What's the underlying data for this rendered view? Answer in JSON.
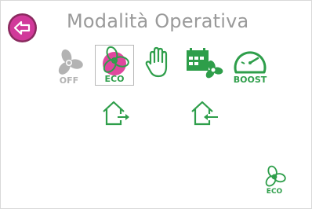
{
  "header": {
    "title": "Modalità Operativa",
    "back_icon": "back-arrow-icon"
  },
  "modes": [
    {
      "id": "off",
      "label": "OFF",
      "icon": "fan-icon",
      "color": "#b3b3b3",
      "selected": false
    },
    {
      "id": "eco",
      "label": "ECO",
      "icon": "fan-icon",
      "color": "#2e9e4a",
      "selected": true
    },
    {
      "id": "manual",
      "label": "",
      "icon": "hand-icon",
      "color": "#2e9e4a",
      "selected": false
    },
    {
      "id": "schedule",
      "label": "",
      "icon": "calendar-fan-icon",
      "color": "#2e9e4a",
      "selected": false
    },
    {
      "id": "boost",
      "label": "BOOST",
      "icon": "gauge-icon",
      "color": "#2e9e4a",
      "selected": false
    }
  ],
  "flow": [
    {
      "id": "extract",
      "icon": "house-arrow-out-icon"
    },
    {
      "id": "supply",
      "icon": "house-arrow-in-icon"
    }
  ],
  "status": {
    "label": "ECO",
    "icon": "fan-icon"
  },
  "colors": {
    "accent": "#2e9e4a",
    "highlight": "#e0479e",
    "back": "#8a2a5f",
    "inactive": "#b3b3b3",
    "title": "#9a9a9a"
  }
}
